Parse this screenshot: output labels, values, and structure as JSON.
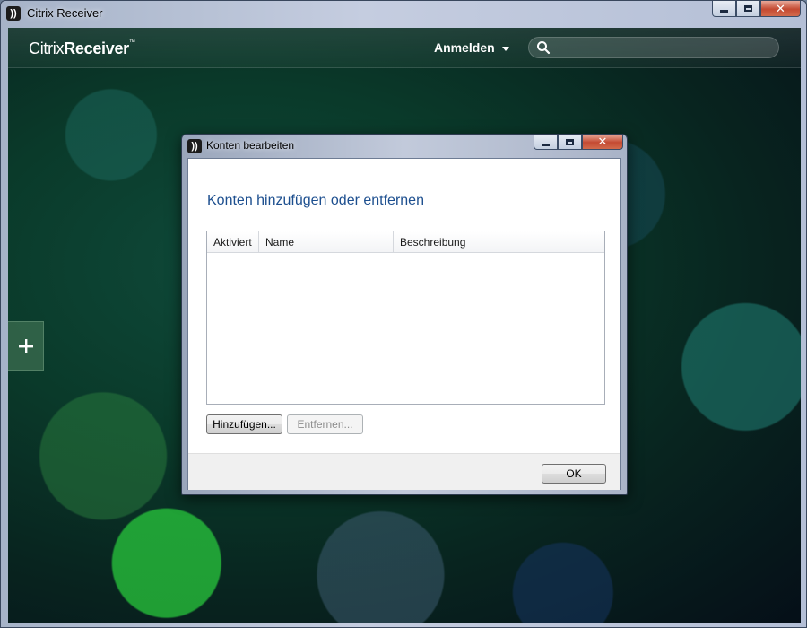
{
  "window": {
    "title": "Citrix Receiver"
  },
  "topbar": {
    "brand_regular": "Citrix",
    "brand_bold": "Receiver",
    "brand_tm": "™",
    "signin_label": "Anmelden",
    "search_placeholder": ""
  },
  "sidebar": {
    "add_symbol": "+"
  },
  "dialog": {
    "title": "Konten bearbeiten",
    "heading": "Konten hinzufügen oder entfernen",
    "columns": [
      "Aktiviert",
      "Name",
      "Beschreibung"
    ],
    "rows": [],
    "add_button": "Hinzufügen...",
    "remove_button": "Entfernen...",
    "ok_button": "OK"
  },
  "colors": {
    "heading_blue": "#1d4f8f",
    "close_red": "#c44a32"
  }
}
